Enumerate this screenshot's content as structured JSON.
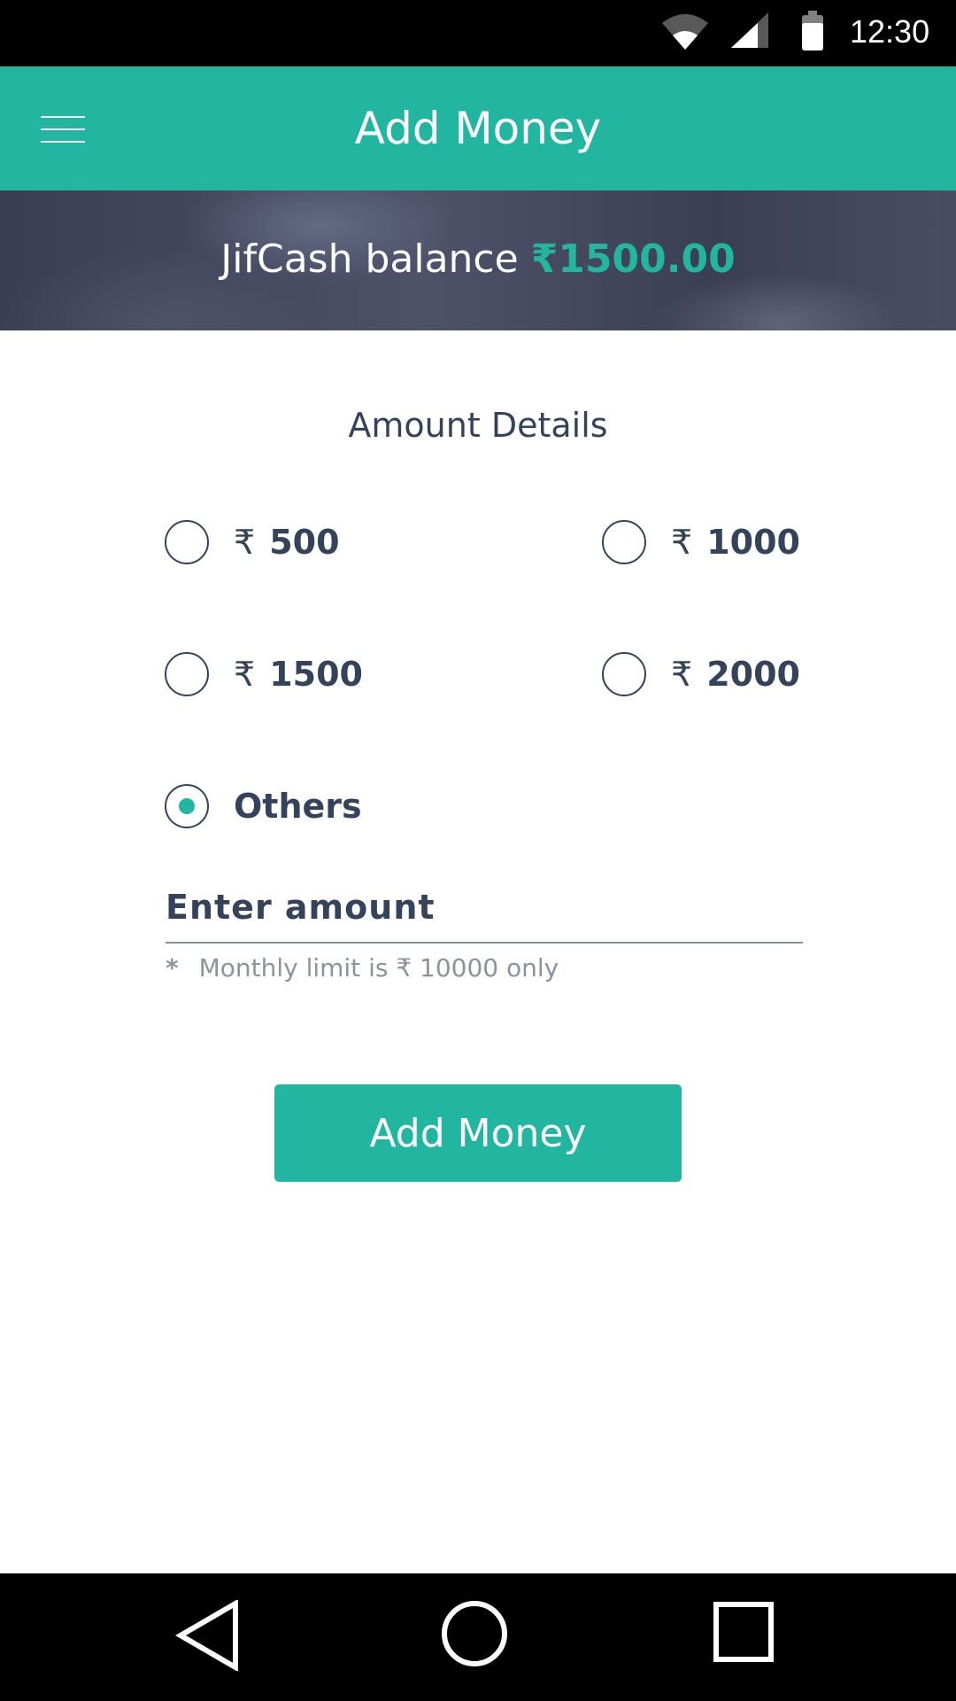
{
  "status_bar": {
    "time": "12:30",
    "icons": [
      "wifi-icon",
      "cell-signal-icon",
      "battery-icon"
    ]
  },
  "toolbar": {
    "menu_icon": "hamburger-menu-icon",
    "title": "Add Money"
  },
  "balance": {
    "label": "JifCash balance",
    "currency": "₹",
    "amount": "1500.00"
  },
  "amount_details": {
    "title": "Amount Details",
    "options": [
      {
        "currency": "₹",
        "value": "500",
        "selected": false
      },
      {
        "currency": "₹",
        "value": "1000",
        "selected": false
      },
      {
        "currency": "₹",
        "value": "1500",
        "selected": false
      },
      {
        "currency": "₹",
        "value": "2000",
        "selected": false
      },
      {
        "currency": "",
        "value": "Others",
        "selected": true
      }
    ],
    "input": {
      "placeholder": "Enter amount",
      "value": ""
    },
    "limit_note": {
      "marker": "*",
      "text": "Monthly limit is ₹ 10000 only"
    }
  },
  "submit_button": {
    "label": "Add Money"
  },
  "nav_bar": {
    "icons": [
      "back-icon",
      "home-icon",
      "recent-apps-icon"
    ]
  },
  "colors": {
    "primary": "#22b5a0",
    "text_dark": "#34435a",
    "text_muted": "#8d939c"
  }
}
